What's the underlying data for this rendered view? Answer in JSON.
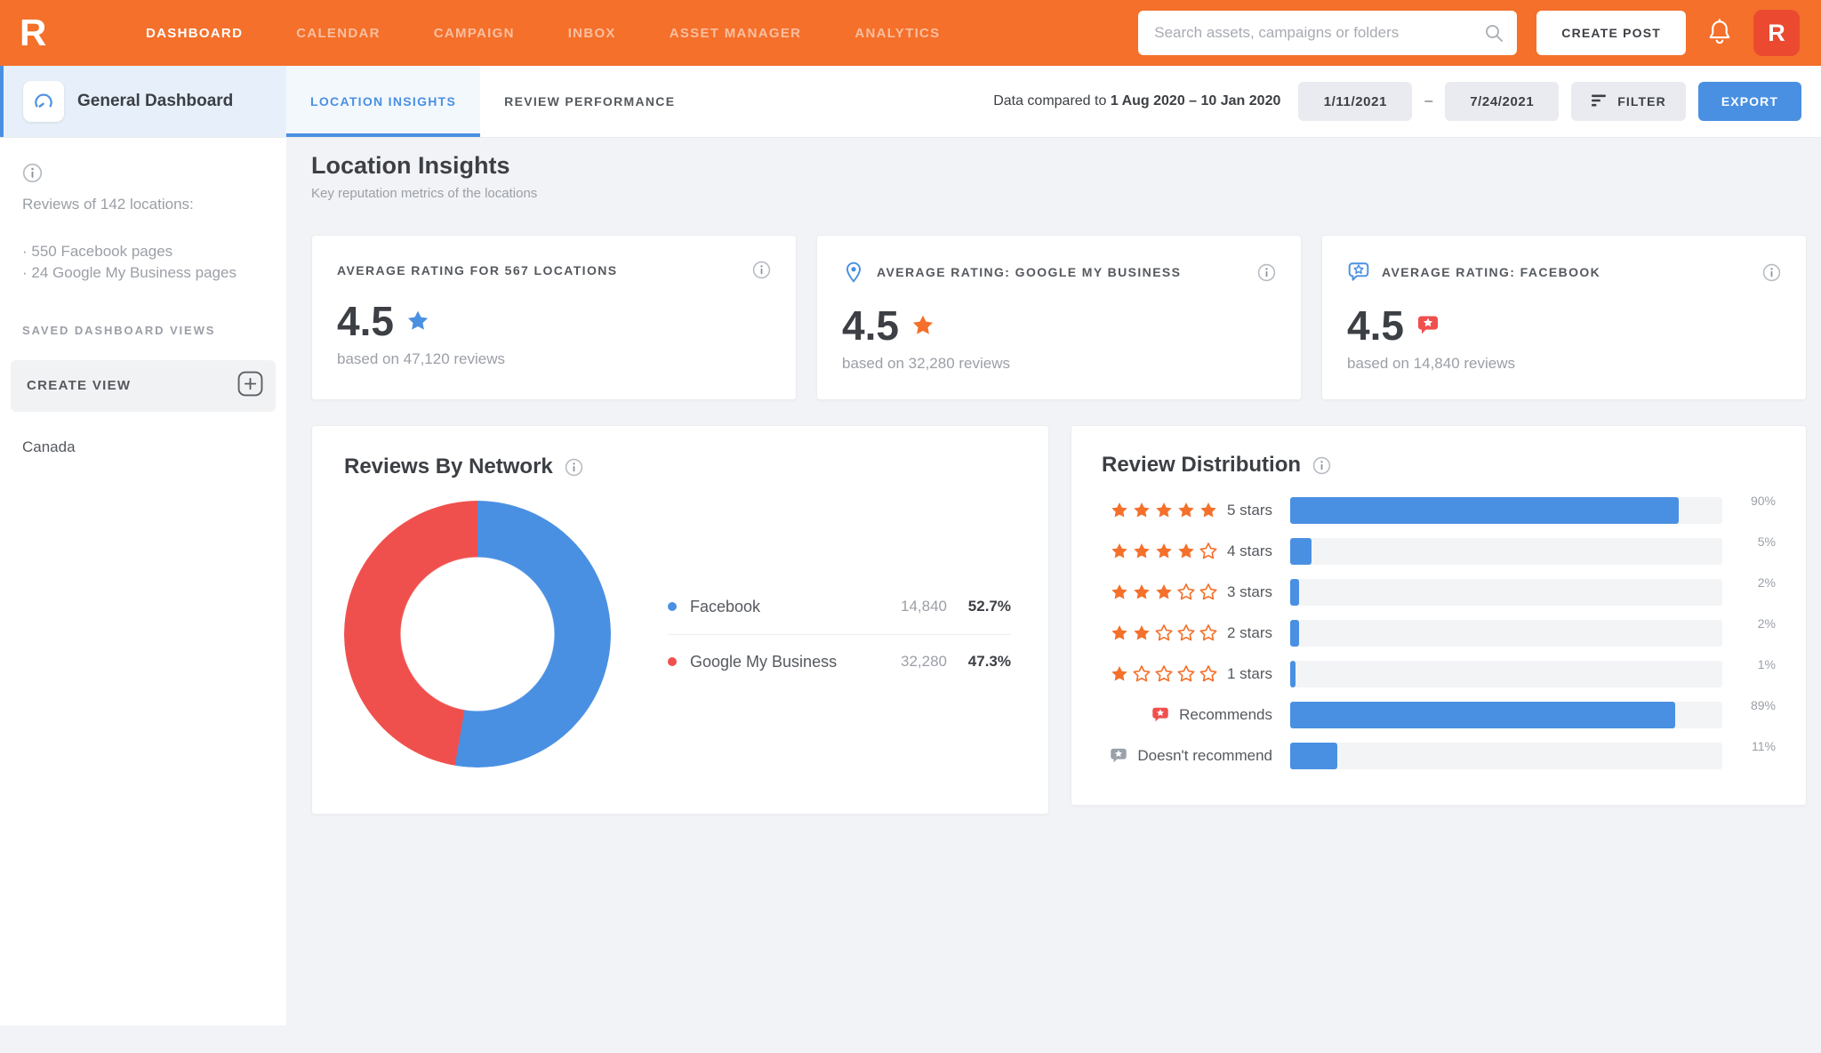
{
  "colors": {
    "brand_orange": "#F4702B",
    "accent_blue": "#4A90E2",
    "coral_red": "#F0504D",
    "avatar_red": "#EB4A31",
    "star_orange": "#F4702B",
    "muted_gray": "#9B9FA6",
    "dark_text": "#3C3F44",
    "bar_track": "#F3F4F6"
  },
  "icons": {
    "brand-logo": "R monogram",
    "search-icon": "magnifier",
    "bell-icon": "notification bell",
    "gauge-icon": "dashboard speedometer",
    "info-icon": "circled i",
    "location-pin-icon": "map pin",
    "review-bubble-icon": "speech bubble with star",
    "star-icon": "five point star",
    "plus-icon": "boxed plus",
    "filter-icon": "three decreasing lines"
  },
  "topnav": {
    "brand": "R",
    "items": [
      {
        "label": "DASHBOARD",
        "active": true
      },
      {
        "label": "CALENDAR",
        "active": false
      },
      {
        "label": "CAMPAIGN",
        "active": false
      },
      {
        "label": "INBOX",
        "active": false
      },
      {
        "label": "ASSET MANAGER",
        "active": false
      },
      {
        "label": "ANALYTICS",
        "active": false
      }
    ],
    "search_placeholder": "Search assets, campaigns or folders",
    "create_post_label": "CREATE POST",
    "avatar_text": "R"
  },
  "subheader": {
    "dashboard_name": "General Dashboard",
    "tabs": [
      {
        "label": "LOCATION INSIGHTS",
        "active": true
      },
      {
        "label": "REVIEW PERFORMANCE",
        "active": false
      }
    ],
    "compare_prefix": "Data compared to",
    "compare_range": "1 Aug 2020 – 10 Jan 2020",
    "date_from": "1/11/2021",
    "date_separator": "–",
    "date_to": "7/24/2021",
    "filter_label": "FILTER",
    "export_label": "EXPORT"
  },
  "sidebar": {
    "summary_title": "Reviews of 142 locations:",
    "summary_items": [
      "· 550 Facebook pages",
      "· 24 Google My Business pages"
    ],
    "saved_views_label": "SAVED DASHBOARD VIEWS",
    "create_view_label": "CREATE VIEW",
    "views": [
      "Canada"
    ]
  },
  "page": {
    "title": "Location Insights",
    "subtitle": "Key reputation metrics of the locations"
  },
  "summary_cards": [
    {
      "label": "AVERAGE RATING FOR 567 LOCATIONS",
      "icon": "none",
      "rating": "4.5",
      "rating_icon": "star-blue",
      "caption": "based on 47,120 reviews"
    },
    {
      "label": "AVERAGE RATING: GOOGLE MY BUSINESS",
      "icon": "location-pin",
      "rating": "4.5",
      "rating_icon": "star-orange",
      "caption": "based on 32,280 reviews"
    },
    {
      "label": "AVERAGE RATING: FACEBOOK",
      "icon": "bubble-outline-blue",
      "rating": "4.5",
      "rating_icon": "bubble-red",
      "caption": "based on 14,840 reviews"
    }
  ],
  "chart_data": [
    {
      "type": "pie",
      "title": "Reviews By Network",
      "donut": true,
      "legend_position": "right",
      "slices": [
        {
          "label": "Facebook",
          "value": 14840,
          "value_display": "14,840",
          "percent": 52.7,
          "percent_display": "52.7%",
          "color": "#4A90E2"
        },
        {
          "label": "Google My Business",
          "value": 32280,
          "value_display": "32,280",
          "percent": 47.3,
          "percent_display": "47.3%",
          "color": "#F0504D"
        }
      ]
    },
    {
      "type": "bar",
      "title": "Review Distribution",
      "orientation": "horizontal",
      "xlim": [
        0,
        100
      ],
      "bar_color": "#4A90E2",
      "rows": [
        {
          "label": "5 stars",
          "stars_filled": 5,
          "stars_total": 5,
          "percent": 90,
          "percent_display": "90%"
        },
        {
          "label": "4 stars",
          "stars_filled": 4,
          "stars_total": 5,
          "percent": 5,
          "percent_display": "5%"
        },
        {
          "label": "3 stars",
          "stars_filled": 3,
          "stars_total": 5,
          "percent": 2,
          "percent_display": "2%"
        },
        {
          "label": "2 stars",
          "stars_filled": 2,
          "stars_total": 5,
          "percent": 2,
          "percent_display": "2%"
        },
        {
          "label": "1 stars",
          "stars_filled": 1,
          "stars_total": 5,
          "percent": 1,
          "percent_display": "1%"
        },
        {
          "label": "Recommends",
          "badge": "bubble-red",
          "percent": 89,
          "percent_display": "89%"
        },
        {
          "label": "Doesn't recommend",
          "badge": "bubble-gray",
          "percent": 11,
          "percent_display": "11%"
        }
      ]
    }
  ]
}
